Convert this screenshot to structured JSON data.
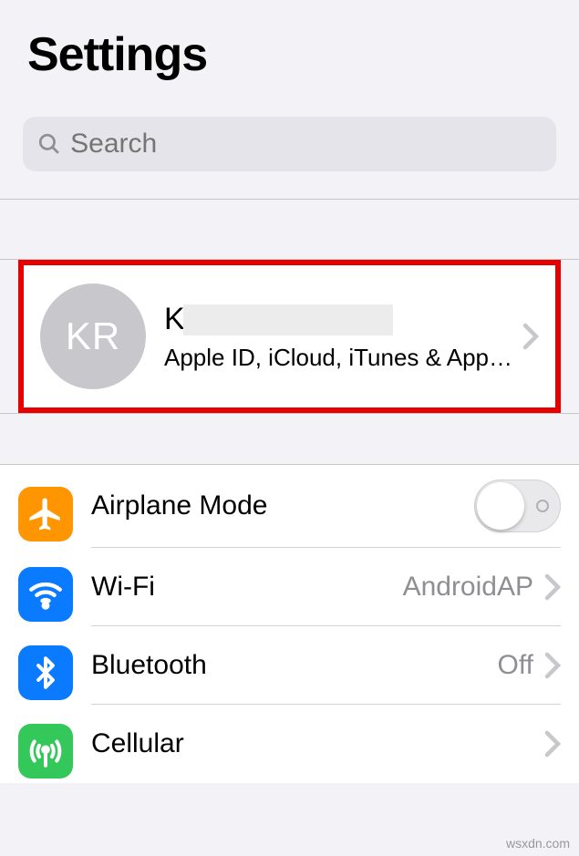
{
  "header": {
    "title": "Settings"
  },
  "search": {
    "placeholder": "Search"
  },
  "account": {
    "initials": "KR",
    "name_prefix": "K",
    "subtitle": "Apple ID, iCloud, iTunes & App…"
  },
  "rows": {
    "airplane": {
      "label": "Airplane Mode",
      "color": "#ff9500"
    },
    "wifi": {
      "label": "Wi-Fi",
      "value": "AndroidAP",
      "color": "#0a7aff"
    },
    "bluetooth": {
      "label": "Bluetooth",
      "value": "Off",
      "color": "#0a7aff"
    },
    "cellular": {
      "label": "Cellular",
      "color": "#34c759"
    }
  },
  "watermark": "wsxdn.com"
}
